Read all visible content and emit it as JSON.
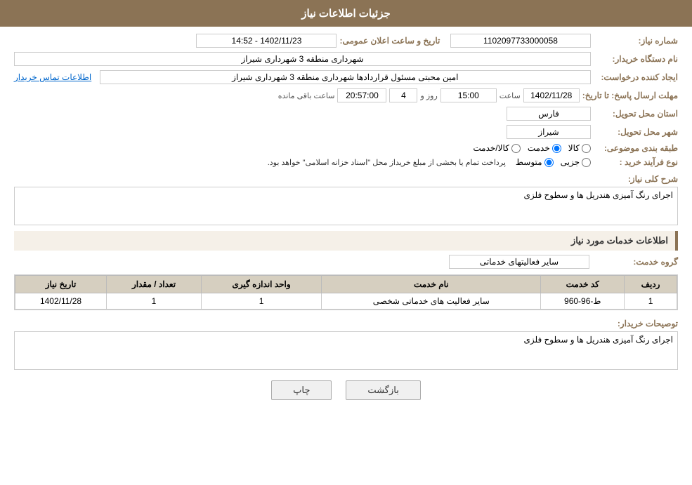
{
  "header": {
    "title": "جزئیات اطلاعات نیاز"
  },
  "fields": {
    "need_number_label": "شماره نیاز:",
    "need_number_value": "1102097733000058",
    "announce_label": "تاریخ و ساعت اعلان عمومی:",
    "announce_value": "1402/11/23 - 14:52",
    "buyer_org_label": "نام دستگاه خریدار:",
    "buyer_org_value": "شهرداری منطقه 3 شهرداری شیراز",
    "creator_label": "ایجاد کننده درخواست:",
    "creator_value": "امین محبتی مسئول قراردادها شهرداری منطقه 3 شهرداری شیراز",
    "contact_link": "اطلاعات تماس خریدار",
    "deadline_label": "مهلت ارسال پاسخ: تا تاریخ:",
    "deadline_date": "1402/11/28",
    "deadline_time_label": "ساعت",
    "deadline_time": "15:00",
    "deadline_days_label": "روز و",
    "deadline_days": "4",
    "deadline_remaining_label": "ساعت باقی مانده",
    "deadline_remaining": "20:57:00",
    "province_label": "استان محل تحویل:",
    "province_value": "فارس",
    "city_label": "شهر محل تحویل:",
    "city_value": "شیراز",
    "category_label": "طبقه بندی موضوعی:",
    "category_options": [
      "کالا",
      "خدمت",
      "کالا/خدمت"
    ],
    "category_selected": "خدمت",
    "process_label": "نوع فرآیند خرید :",
    "process_options": [
      "جزیی",
      "متوسط"
    ],
    "process_note": "پرداخت تمام یا بخشی از مبلغ خریداز محل \"اسناد خزانه اسلامی\" خواهد بود.",
    "need_desc_label": "شرح کلی نیاز:",
    "need_desc_value": "اجرای رنگ آمیزی هندریل ها و سطوح فلزی"
  },
  "services_section": {
    "title": "اطلاعات خدمات مورد نیاز",
    "service_group_label": "گروه خدمت:",
    "service_group_value": "سایر فعالیتهای خدماتی",
    "table": {
      "headers": [
        "ردیف",
        "کد خدمت",
        "نام خدمت",
        "واحد اندازه گیری",
        "تعداد / مقدار",
        "تاریخ نیاز"
      ],
      "rows": [
        {
          "row": "1",
          "code": "ط-96-960",
          "name": "سایر فعالیت های خدماتی شخصی",
          "unit": "1",
          "count": "1",
          "date": "1402/11/28"
        }
      ]
    }
  },
  "buyer_desc_label": "توصیحات خریدار:",
  "buyer_desc_value": "اجرای رنگ آمیزی هندریل ها و سطوح فلزی",
  "buttons": {
    "print": "چاپ",
    "back": "بازگشت"
  }
}
